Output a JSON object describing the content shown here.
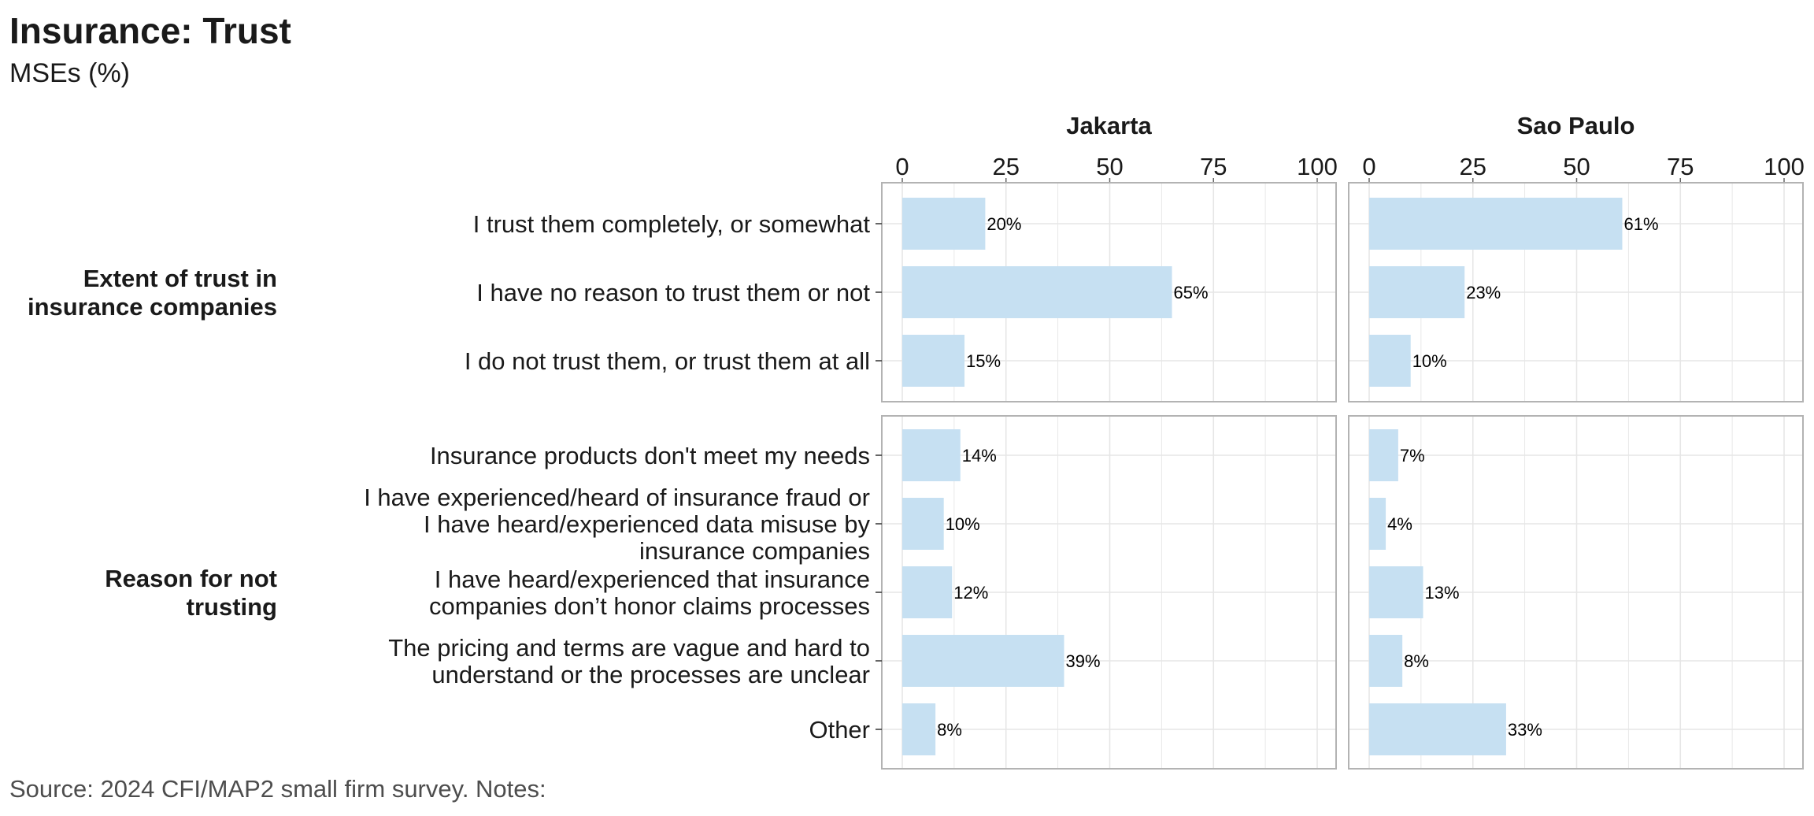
{
  "title": "Insurance: Trust",
  "subtitle": "MSEs (%)",
  "source": "Source: 2024 CFI/MAP2 small firm survey. Notes:",
  "chart_data": {
    "type": "bar",
    "orientation": "horizontal",
    "xlim": [
      0,
      100
    ],
    "x_ticks": [
      "0",
      "25",
      "50",
      "75",
      "100"
    ],
    "grid": true,
    "facets": [
      "Jakarta",
      "Sao Paulo"
    ],
    "bar_color": "#c6e0f2",
    "groups": [
      {
        "label": "Extent of trust in insurance companies",
        "categories": [
          "I trust them completely, or somewhat",
          "I have no reason to trust them or not",
          "I do not trust them, or trust them at all"
        ],
        "series": [
          {
            "facet": "Jakarta",
            "values": [
              20,
              65,
              15
            ],
            "labels": [
              "20%",
              "65%",
              "15%"
            ]
          },
          {
            "facet": "Sao Paulo",
            "values": [
              61,
              23,
              10
            ],
            "labels": [
              "61%",
              "23%",
              "10%"
            ]
          }
        ]
      },
      {
        "label": "Reason for not trusting",
        "categories": [
          "Insurance products don't meet my needs",
          "I have experienced/heard of insurance fraud or I have heard/experienced data misuse by insurance companies",
          "I have heard/experienced that insurance companies don’t honor claims processes",
          "The pricing and terms are vague and hard to understand or the processes are unclear",
          "Other"
        ],
        "series": [
          {
            "facet": "Jakarta",
            "values": [
              14,
              10,
              12,
              39,
              8
            ],
            "labels": [
              "14%",
              "10%",
              "12%",
              "39%",
              "8%"
            ]
          },
          {
            "facet": "Sao Paulo",
            "values": [
              7,
              4,
              13,
              8,
              33
            ],
            "labels": [
              "7%",
              "4%",
              "13%",
              "8%",
              "33%"
            ]
          }
        ]
      }
    ]
  }
}
